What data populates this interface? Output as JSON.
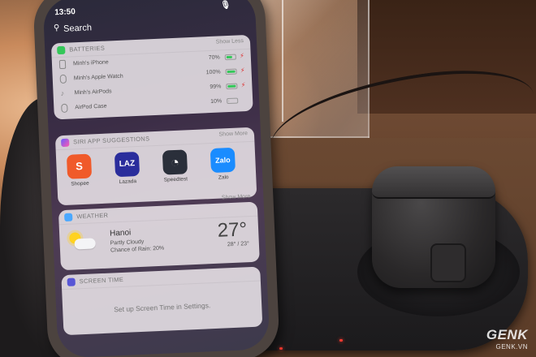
{
  "status_bar": {
    "time": "13:50",
    "mic_icon": "mic-icon"
  },
  "search": {
    "label": "Search",
    "icon": "search-icon"
  },
  "batteries": {
    "title": "BATTERIES",
    "action": "Show Less",
    "devices": [
      {
        "name": "Minh's iPhone",
        "percent": "70%",
        "level": 0.7,
        "icon": "iphone-icon",
        "charging": true
      },
      {
        "name": "Minh's Apple Watch",
        "percent": "100%",
        "level": 1.0,
        "icon": "watch-icon",
        "charging": true
      },
      {
        "name": "Minh's AirPods",
        "percent": "99%",
        "level": 0.99,
        "icon": "airpods-icon",
        "charging": true
      },
      {
        "name": "AirPod Case",
        "percent": "10%",
        "level": 0.1,
        "icon": "airpods-case-icon",
        "charging": false
      }
    ]
  },
  "siri": {
    "title": "SIRI APP SUGGESTIONS",
    "action": "Show More",
    "apps": [
      {
        "label": "Shopee",
        "glyph": "S",
        "color": "#f05a2a"
      },
      {
        "label": "Lazada",
        "glyph": "LAZ",
        "color": "#2a2d9c"
      },
      {
        "label": "Speedtest",
        "glyph": "◔",
        "color": "#2a2f3a"
      },
      {
        "label": "Zalo",
        "glyph": "Zalo",
        "color": "#1a8cff"
      }
    ]
  },
  "weather": {
    "title": "WEATHER",
    "action": "Show More",
    "city": "Hanoi",
    "condition": "Partly Cloudy",
    "rain": "Chance of Rain: 20%",
    "temp": "27°",
    "hilo": "28° / 23°",
    "icon": "partly-cloudy-icon"
  },
  "screen_time": {
    "title": "SCREEN TIME",
    "message": "Set up Screen Time in Settings."
  },
  "watermark": {
    "logo": "GENK",
    "url": "GENK.VN"
  }
}
